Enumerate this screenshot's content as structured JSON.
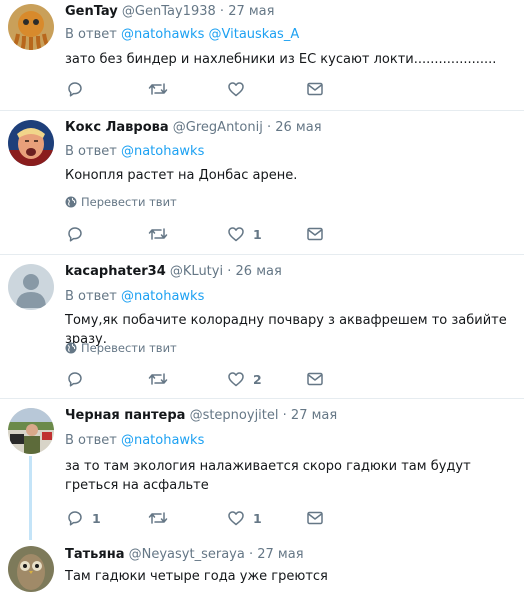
{
  "tweets": [
    {
      "name": "GenTay",
      "handle": "@GenTay1938",
      "date": "27 мая",
      "reply_prefix": "В ответ",
      "mentions": [
        "@natohawks",
        "@Vitauskas_A"
      ],
      "text": "зато без биндер и нахлебники из ЕС кусают локти....................",
      "translate": "",
      "counts": {
        "reply": "",
        "retweet": "",
        "like": ""
      }
    },
    {
      "name": "Кокс Лаврова",
      "handle": "@GregAntonij",
      "date": "26 мая",
      "reply_prefix": "В ответ",
      "mentions": [
        "@natohawks"
      ],
      "text": "Конопля растет на Донбас арене.",
      "translate": "Перевести твит",
      "counts": {
        "reply": "",
        "retweet": "",
        "like": "1"
      }
    },
    {
      "name": "kacaphater34",
      "handle": "@KLutyi",
      "date": "26 мая",
      "reply_prefix": "В ответ",
      "mentions": [
        "@natohawks"
      ],
      "text": "Тому,як побачите колорадну почвару з аквафрешем то забийте зразу.",
      "translate": "Перевести твит",
      "counts": {
        "reply": "",
        "retweet": "",
        "like": "2"
      }
    },
    {
      "name": "Черная пантера",
      "handle": "@stepnoyjitel",
      "date": "27 мая",
      "reply_prefix": "В ответ",
      "mentions": [
        "@natohawks"
      ],
      "text": "за то там экология налаживается  скоро гадюки там будут греться на асфальте",
      "translate": "",
      "counts": {
        "reply": "1",
        "retweet": "",
        "like": "1"
      }
    },
    {
      "name": "Татьяна",
      "handle": "@Neyasyt_seraya",
      "date": "27 мая",
      "text": "Там гадюки четыре года уже греются"
    }
  ],
  "colors": {
    "link": "#1da1f2",
    "muted": "#657786",
    "thread": "#c4e4f8",
    "separator": "#e6ecf0"
  },
  "icons": [
    "reply-icon",
    "retweet-icon",
    "like-icon",
    "dm-icon",
    "globe-icon"
  ]
}
